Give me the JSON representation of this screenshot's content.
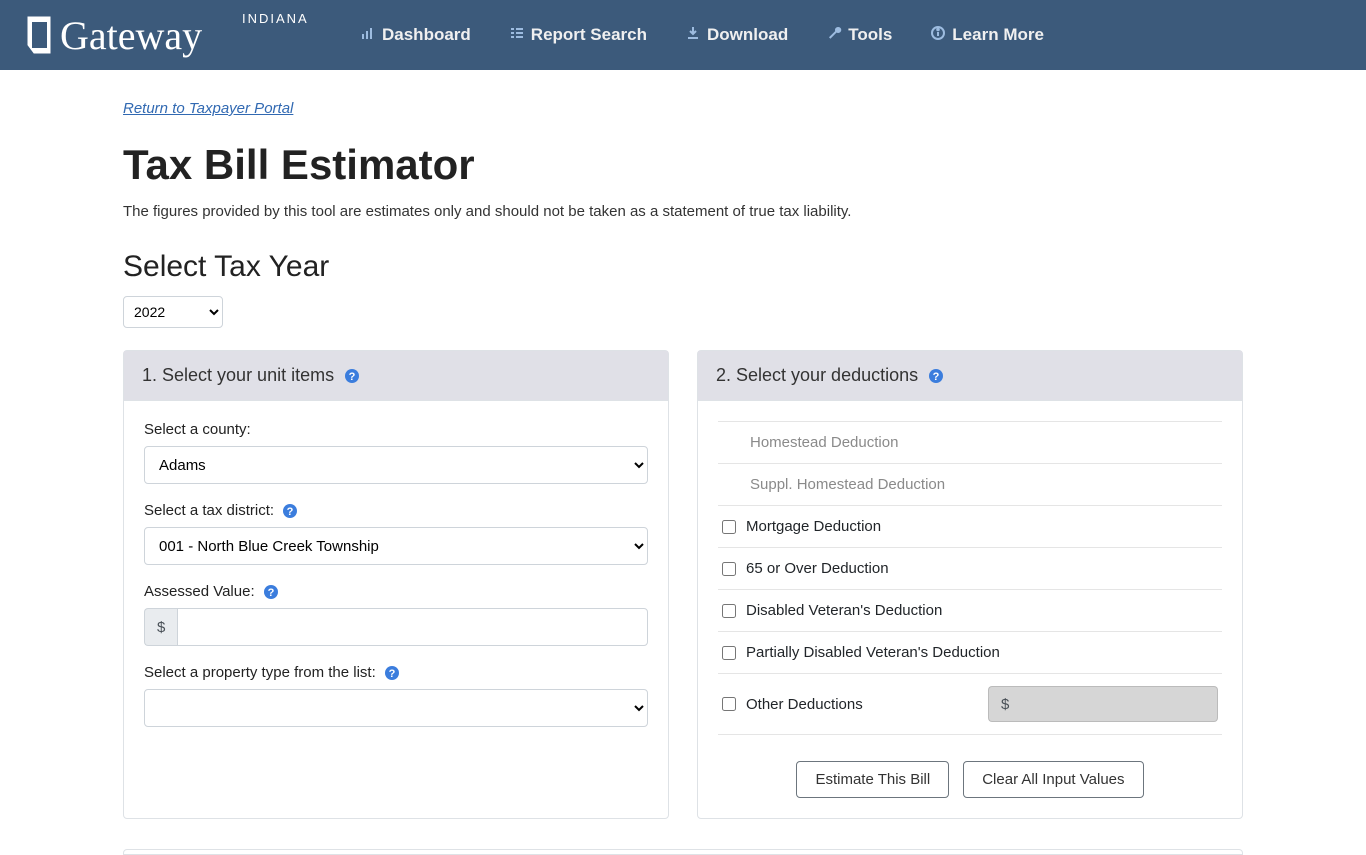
{
  "nav": {
    "dashboard": "Dashboard",
    "report_search": "Report Search",
    "download": "Download",
    "tools": "Tools",
    "learn_more": "Learn More"
  },
  "return_link": "Return to Taxpayer Portal",
  "title": "Tax Bill Estimator",
  "disclaimer": "The figures provided by this tool are estimates only and should not be taken as a statement of true tax liability.",
  "select_year_heading": "Select Tax Year",
  "year_value": "2022",
  "panel1": {
    "title": "1. Select your unit items",
    "county_label": "Select a county:",
    "county_value": "Adams",
    "district_label": "Select a tax district:",
    "district_value": "001 - North Blue Creek Township",
    "assessed_label": "Assessed Value:",
    "currency": "$",
    "property_label": "Select a property type from the list:"
  },
  "panel2": {
    "title": "2. Select your deductions",
    "items": {
      "homestead": "Homestead Deduction",
      "suppl": "Suppl. Homestead Deduction",
      "mortgage": "Mortgage Deduction",
      "over65": "65 or Over Deduction",
      "disabled_vet": "Disabled Veteran's Deduction",
      "partial_vet": "Partially Disabled Veteran's Deduction",
      "other": "Other Deductions"
    },
    "currency": "$"
  },
  "buttons": {
    "estimate": "Estimate This Bill",
    "clear": "Clear All Input Values"
  }
}
